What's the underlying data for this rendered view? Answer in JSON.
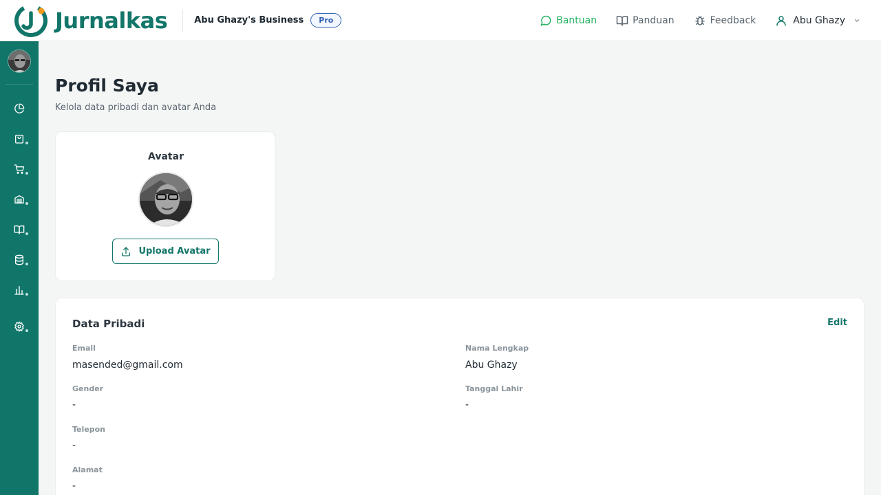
{
  "header": {
    "app_name": "Jurnalkas",
    "business_name": "Abu Ghazy's Business",
    "plan_badge": "Pro",
    "links": {
      "help": "Bantuan",
      "guide": "Panduan",
      "feedback": "Feedback"
    },
    "user_name": "Abu Ghazy"
  },
  "sidebar": {
    "items": [
      {
        "icon": "pie-chart-icon",
        "has_dot": false
      },
      {
        "icon": "shopping-bag-icon",
        "has_dot": true
      },
      {
        "icon": "cart-icon",
        "has_dot": true
      },
      {
        "icon": "inventory-icon",
        "has_dot": true
      },
      {
        "icon": "book-icon",
        "has_dot": true
      },
      {
        "icon": "database-icon",
        "has_dot": true
      },
      {
        "icon": "bar-chart-icon",
        "has_dot": true
      },
      {
        "icon": "gear-icon",
        "has_dot": true
      }
    ]
  },
  "page": {
    "title": "Profil Saya",
    "subtitle": "Kelola data pribadi dan avatar Anda"
  },
  "avatar_card": {
    "label": "Avatar",
    "upload_button": "Upload Avatar"
  },
  "personal_data": {
    "title": "Data Pribadi",
    "edit_label": "Edit",
    "fields": {
      "email": {
        "label": "Email",
        "value": "masended@gmail.com"
      },
      "full_name": {
        "label": "Nama Lengkap",
        "value": "Abu Ghazy"
      },
      "gender": {
        "label": "Gender",
        "value": "-"
      },
      "birth_date": {
        "label": "Tanggal Lahir",
        "value": "-"
      },
      "phone": {
        "label": "Telepon",
        "value": "-"
      },
      "address": {
        "label": "Alamat",
        "value": "-"
      }
    }
  },
  "colors": {
    "brand": "#13766a",
    "sidebar": "#11766a",
    "help_link": "#22b35e",
    "badge": "#2f5fb3"
  }
}
